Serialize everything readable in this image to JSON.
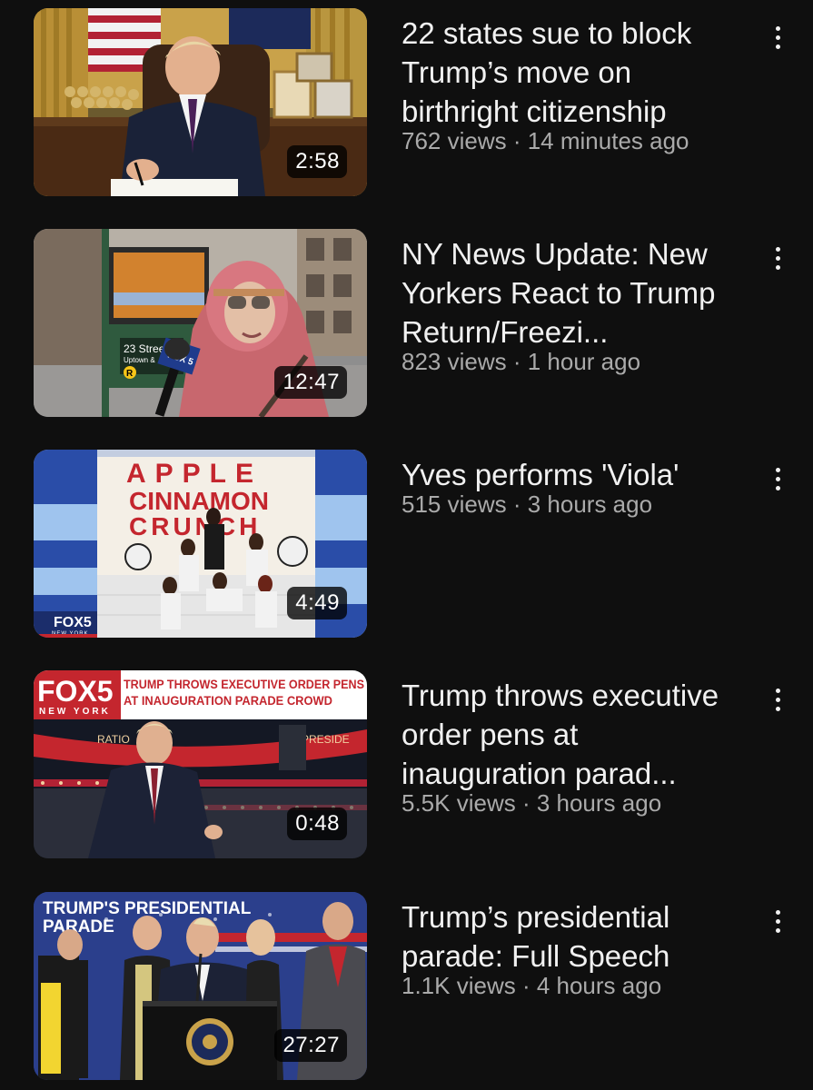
{
  "videos": [
    {
      "title": "22 states sue to block Trump’s move on birthright citizenship",
      "meta": "762 views · 14 minutes ago",
      "duration": "2:58",
      "thumbnail_icon": "oval-office-signing-thumbnail"
    },
    {
      "title": "NY News Update: New Yorkers React to Trump Return/Freezi...",
      "meta": "823 views · 1 hour ago",
      "duration": "12:47",
      "thumbnail_icon": "street-interview-thumbnail",
      "thumb_text": {
        "station": "23 Street",
        "direction": "Uptown &",
        "line": "R",
        "mic_flag": "FOX 5"
      }
    },
    {
      "title": "Yves performs 'Viola'",
      "meta": "515 views · 3 hours ago",
      "duration": "4:49",
      "thumbnail_icon": "studio-performance-thumbnail",
      "thumb_text": {
        "sign_line1": "APPLE",
        "sign_line2": "CINNAMON",
        "sign_line3": "CRUNCH",
        "logo": "FOX5",
        "logo_sub": "NEW YORK"
      }
    },
    {
      "title": "Trump throws executive order pens at inauguration parad...",
      "meta": "5.5K views · 3 hours ago",
      "duration": "0:48",
      "thumbnail_icon": "arena-parade-thumbnail",
      "thumb_text": {
        "logo": "FOX5",
        "logo_sub": "NEW YORK",
        "headline1": "TRUMP THROWS EXECUTIVE ORDER PENS",
        "headline2": "AT INAUGURATION PARADE CROWD",
        "banner_left": "RATIO",
        "banner_right": "PRESIDE"
      }
    },
    {
      "title": "Trump’s presidential parade: Full Speech",
      "meta": "1.1K views · 4 hours ago",
      "duration": "27:27",
      "thumbnail_icon": "podium-speech-thumbnail",
      "thumb_text": {
        "caption1": "TRUMP'S PRESIDENTIAL",
        "caption2": "PARADE"
      }
    }
  ],
  "colors": {
    "background": "#0f0f0f",
    "title": "#f1f1f1",
    "meta": "#aaaaaa",
    "fox_red": "#d0202e"
  }
}
